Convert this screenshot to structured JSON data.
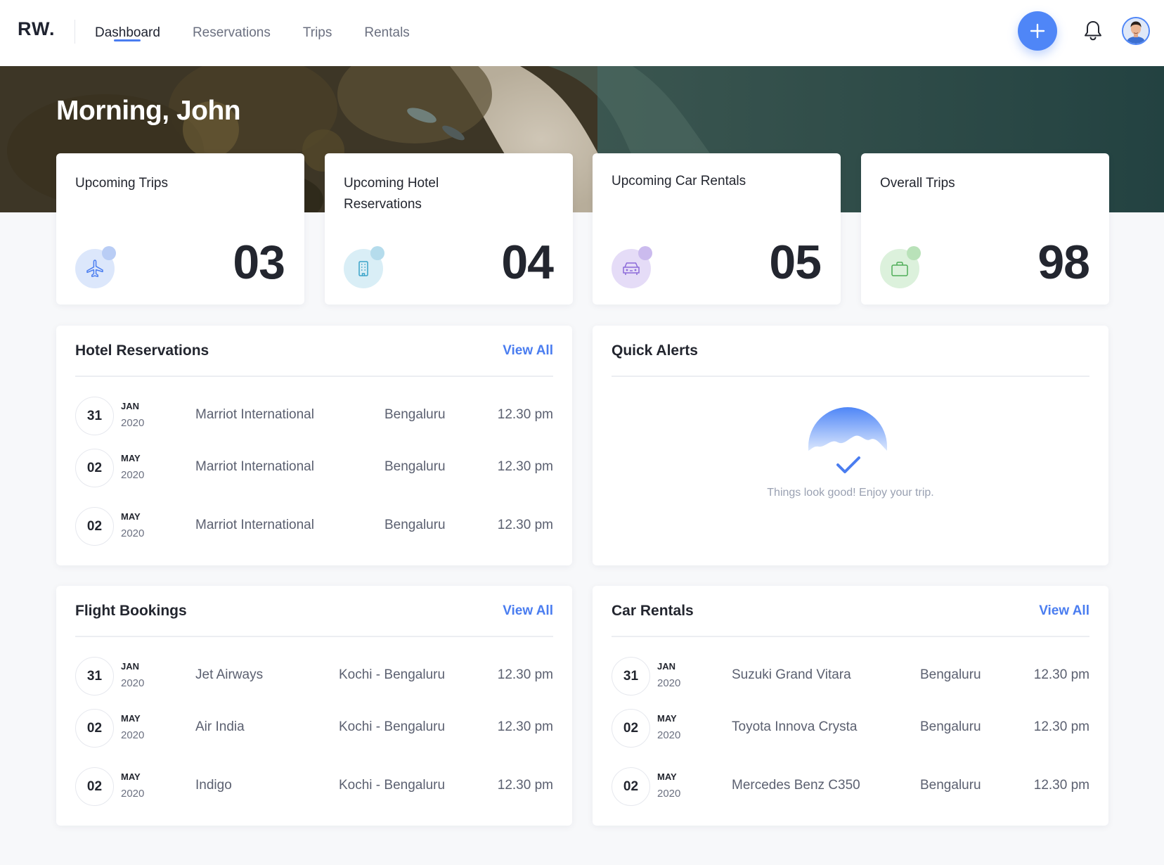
{
  "app": {
    "logo": "RW.",
    "nav": [
      {
        "label": "Dashboard",
        "active": true
      },
      {
        "label": "Reservations",
        "active": false
      },
      {
        "label": "Trips",
        "active": false
      },
      {
        "label": "Rentals",
        "active": false
      }
    ],
    "accent_color": "#4f86f7"
  },
  "hero": {
    "greeting": "Morning, John"
  },
  "stats": [
    {
      "title": "Upcoming Trips",
      "value": "03",
      "icon": "airplane-icon"
    },
    {
      "title": "Upcoming Hotel Reservations",
      "value": "04",
      "icon": "building-icon"
    },
    {
      "title": "Upcoming Car Rentals",
      "value": "05",
      "icon": "car-icon"
    },
    {
      "title": "Overall Trips",
      "value": "98",
      "icon": "briefcase-icon"
    }
  ],
  "hotel_reservations": {
    "title": "Hotel Reservations",
    "view_all": "View All",
    "rows": [
      {
        "day": "31",
        "month": "JAN",
        "year": "2020",
        "name": "Marriot International",
        "place": "Bengaluru",
        "time": "12.30 pm"
      },
      {
        "day": "02",
        "month": "MAY",
        "year": "2020",
        "name": "Marriot International",
        "place": "Bengaluru",
        "time": "12.30 pm"
      },
      {
        "day": "02",
        "month": "MAY",
        "year": "2020",
        "name": "Marriot International",
        "place": "Bengaluru",
        "time": "12.30 pm"
      }
    ]
  },
  "quick_alerts": {
    "title": "Quick Alerts",
    "message": "Things look good!  Enjoy your trip."
  },
  "flight_bookings": {
    "title": "Flight Bookings",
    "view_all": "View All",
    "rows": [
      {
        "day": "31",
        "month": "JAN",
        "year": "2020",
        "name": "Jet Airways",
        "place": "Kochi - Bengaluru",
        "time": "12.30 pm"
      },
      {
        "day": "02",
        "month": "MAY",
        "year": "2020",
        "name": "Air India",
        "place": "Kochi - Bengaluru",
        "time": "12.30 pm"
      },
      {
        "day": "02",
        "month": "MAY",
        "year": "2020",
        "name": "Indigo",
        "place": "Kochi - Bengaluru",
        "time": "12.30 pm"
      }
    ]
  },
  "car_rentals": {
    "title": "Car Rentals",
    "view_all": "View All",
    "rows": [
      {
        "day": "31",
        "month": "JAN",
        "year": "2020",
        "name": "Suzuki Grand Vitara",
        "place": "Bengaluru",
        "time": "12.30 pm"
      },
      {
        "day": "02",
        "month": "MAY",
        "year": "2020",
        "name": "Toyota Innova Crysta",
        "place": "Bengaluru",
        "time": "12.30 pm"
      },
      {
        "day": "02",
        "month": "MAY",
        "year": "2020",
        "name": "Mercedes Benz C350",
        "place": "Bengaluru",
        "time": "12.30 pm"
      }
    ]
  }
}
